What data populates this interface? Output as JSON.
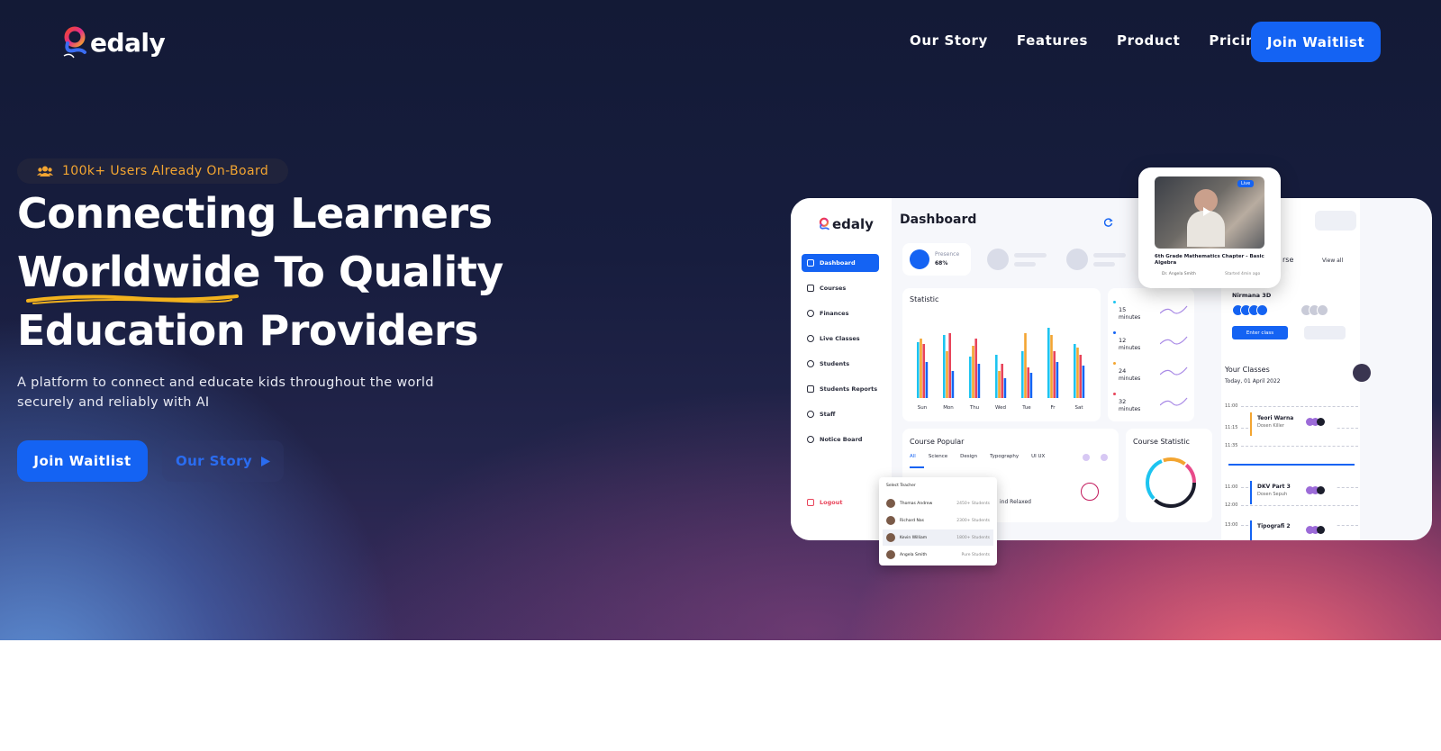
{
  "brand": {
    "name": "edaly"
  },
  "nav": {
    "links": [
      "Our Story",
      "Features",
      "Product",
      "Pricing"
    ],
    "cta": "Join Waitlist"
  },
  "hero": {
    "badge": "100k+ Users Already On-Board",
    "headline_line1": "Connecting Learners",
    "headline_word": "Worldwide",
    "headline_line2_rest": " To Quality",
    "headline_line3": "Education Providers",
    "subtext": "A platform to connect and educate kids throughout the world securely and reliably with AI",
    "cta": "Join Waitlist",
    "secondary": "Our Story"
  },
  "colors": {
    "accent": "#1463f3",
    "badge_text": "#f3a531",
    "highlight": "#f3b21d"
  },
  "dashboard": {
    "logo": "edaly",
    "title": "Dashboard",
    "sidebar": [
      "Dashboard",
      "Courses",
      "Finances",
      "Live Classes",
      "Students",
      "Students Reports",
      "Staff",
      "Notice Board"
    ],
    "logout": "Logout",
    "presence_label": "Presence",
    "presence_value": "68%",
    "statistic_title": "Statistic",
    "days": [
      "Sun",
      "Mon",
      "Thu",
      "Wed",
      "Tue",
      "Fr",
      "Sat"
    ],
    "minutes": [
      {
        "value": "15",
        "unit": "minutes"
      },
      {
        "value": "12",
        "unit": "minutes"
      },
      {
        "value": "24",
        "unit": "minutes"
      },
      {
        "value": "32",
        "unit": "minutes"
      }
    ],
    "course_popular": "Course Popular",
    "course_tabs": [
      "All",
      "Science",
      "Design",
      "Typography",
      "UI UX"
    ],
    "course_statistic": "Course Statistic",
    "relaxed": "ind Relaxed",
    "right_course_fragment": "rse",
    "view_all": "View all",
    "nirmana": "Nirmana 3D",
    "enter_class": "Enter class",
    "your_classes": "Your Classes",
    "today": "Today, 01 April 2022",
    "times": [
      "11:00",
      "11:15",
      "11:35",
      "11:00",
      "12:00",
      "13:00"
    ],
    "classes": [
      {
        "name": "Teori Warna",
        "teacher": "Dosen Killer"
      },
      {
        "name": "DKV Part 3",
        "teacher": "Dosen Sepuh"
      },
      {
        "name": "Tipografi 2",
        "teacher": ""
      }
    ],
    "video": {
      "live": "Live",
      "title": "6th Grade Mathematics Chapter - Basic Algebra",
      "author": "Dr. Angela Smith",
      "meta": "Started 4min ago"
    },
    "teacher_list": {
      "header": "Select Teacher",
      "rows": [
        {
          "name": "Thomas Andrew",
          "count": "2450+ Students"
        },
        {
          "name": "Richard Nas",
          "count": "2300+ Students"
        },
        {
          "name": "Kevin William",
          "count": "1800+ Students"
        },
        {
          "name": "Angela Smith",
          "count": "Pure Students"
        }
      ]
    }
  }
}
